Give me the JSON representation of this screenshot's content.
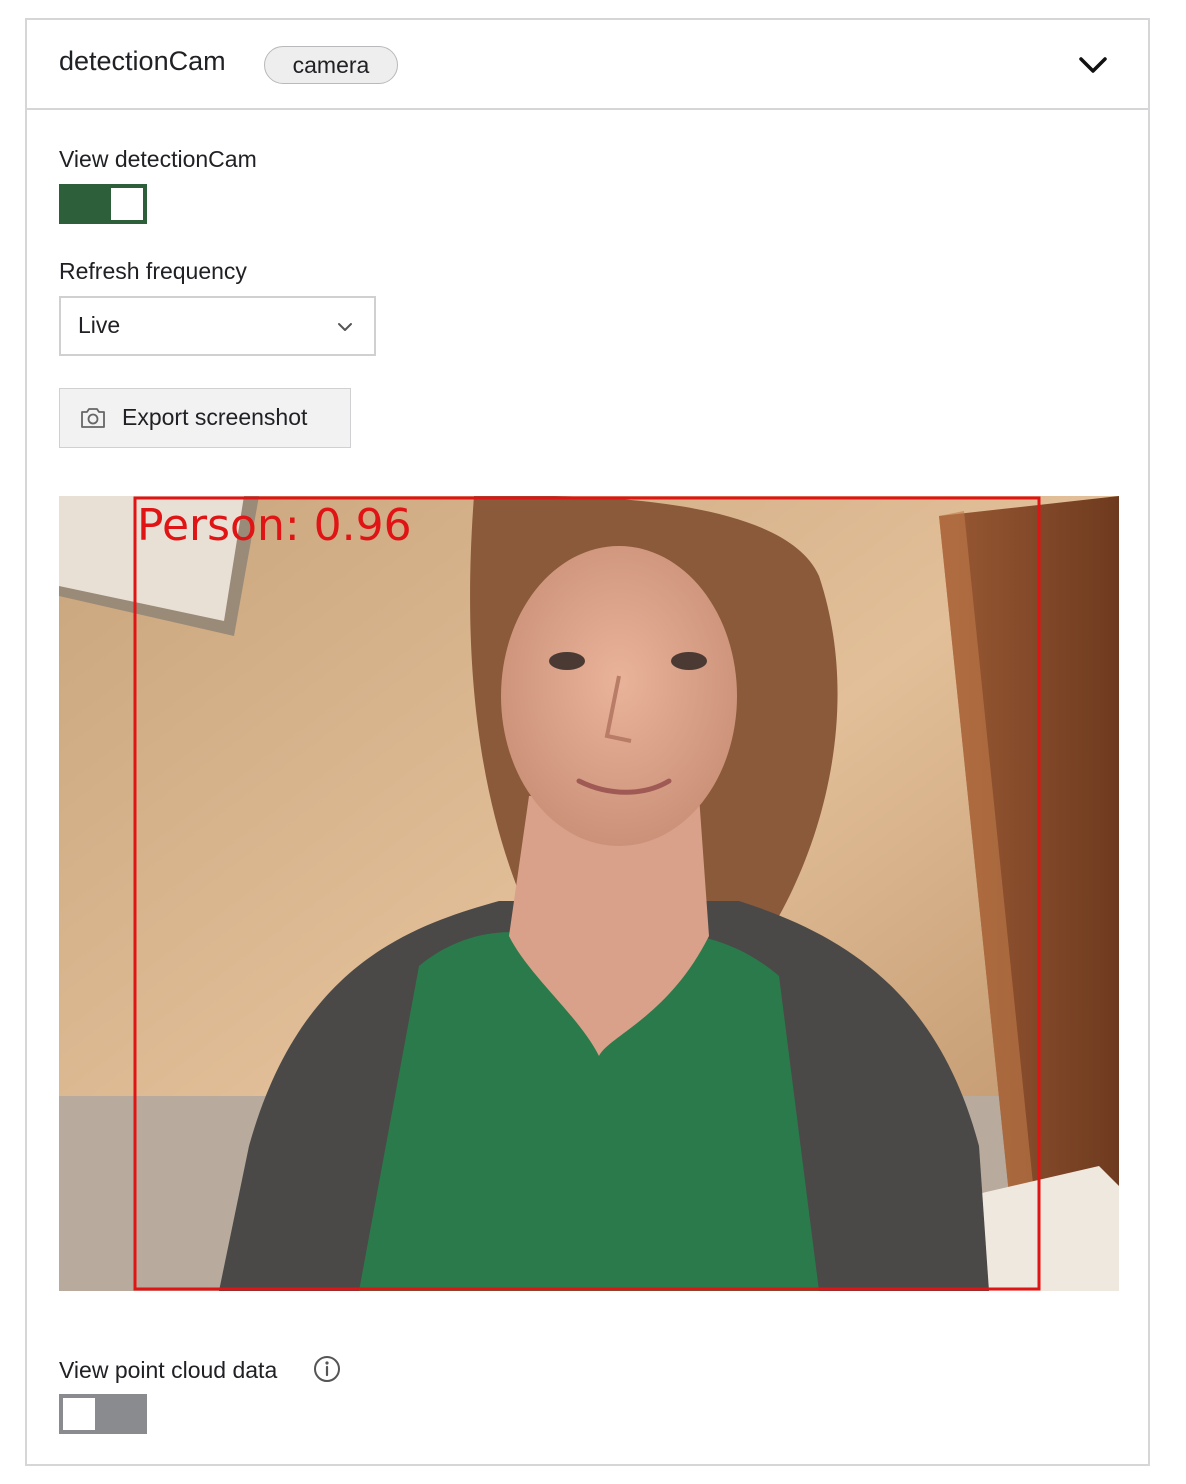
{
  "header": {
    "title": "detectionCam",
    "badge": "camera",
    "collapse_icon": "chevron-down-icon"
  },
  "view_toggle": {
    "label": "View detectionCam",
    "state": "on"
  },
  "refresh": {
    "label": "Refresh frequency",
    "selected": "Live"
  },
  "export": {
    "label": "Export screenshot",
    "icon": "camera-icon"
  },
  "camera_feed": {
    "detection_label": "Person: 0.96",
    "box_color": "#e01414"
  },
  "point_cloud": {
    "label": "View point cloud data",
    "info_icon": "info-icon",
    "state": "off"
  },
  "colors": {
    "toggle_on": "#2d5f3a",
    "toggle_off": "#8a8b8f",
    "border": "#d6d6d8"
  }
}
